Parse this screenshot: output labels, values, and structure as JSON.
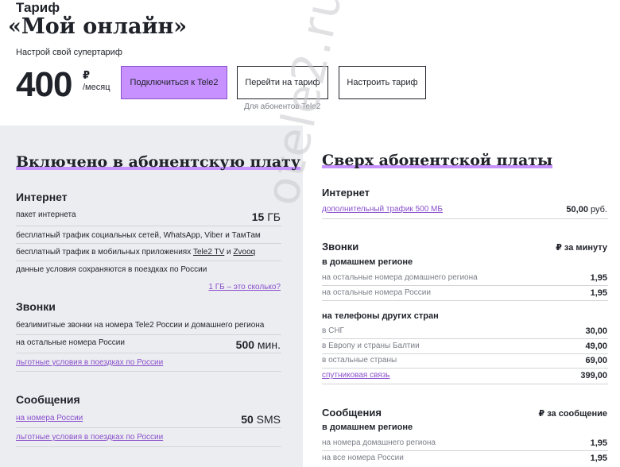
{
  "header": {
    "label": "Тариф",
    "title": "«Мой онлайн»",
    "subtitle": "Настрой свой супертариф",
    "price": "400",
    "currency": "₽",
    "period": "/месяц",
    "buttons": {
      "connect": "Подключиться к Tele2",
      "switch": "Перейти на тариф",
      "configure": "Настроить тариф"
    },
    "switch_note": "Для абонентов Tele2"
  },
  "included": {
    "title": "Включено в абонентскую плату",
    "internet": {
      "heading": "Интернет",
      "package_label": "пакет интернета",
      "package_value": "15",
      "package_unit": "ГБ",
      "line1": "бесплатный трафик социальных сетей, WhatsApp, Viber и ТамТам",
      "line2_prefix": "бесплатный трафик в мобильных приложениях ",
      "line2_app1": "Tele2 TV",
      "line2_and": " и ",
      "line2_app2": "Zvooq",
      "line3": "данные условия сохраняются в поездках по России",
      "gb_link": "1 ГБ – это сколько?"
    },
    "calls": {
      "heading": "Звонки",
      "line1": "безлимитные звонки на номера Tele2 России и домашнего региона",
      "line2": "на остальные номера России",
      "line2_value": "500",
      "line2_unit": "мин.",
      "link": "льготные условия в поездках по России"
    },
    "sms": {
      "heading": "Сообщения",
      "link1": "на номера России",
      "link1_value": "50",
      "link1_unit": "SMS",
      "link2": "льготные условия в поездках по России"
    }
  },
  "extra": {
    "title": "Сверх абонентской платы",
    "internet": {
      "heading": "Интернет",
      "link": "дополнительный трафик 500 МБ",
      "price": "50,00",
      "price_unit": "руб."
    },
    "calls": {
      "heading": "Звонки",
      "hint": "₽ за минуту",
      "home_heading": "в домашнем регионе",
      "home_rows": [
        {
          "label": "на остальные номера домашнего региона",
          "value": "1,95"
        },
        {
          "label": "на остальные номера России",
          "value": "1,95"
        }
      ],
      "intl_heading": "на телефоны других стран",
      "intl_rows": [
        {
          "label": "в СНГ",
          "value": "30,00"
        },
        {
          "label": "в Европу и страны Балтии",
          "value": "49,00"
        },
        {
          "label": "в остальные страны",
          "value": "69,00"
        },
        {
          "label": "спутниковая связь",
          "value": "399,00"
        }
      ]
    },
    "sms": {
      "heading": "Сообщения",
      "hint": "₽ за сообщение",
      "home_heading": "в домашнем регионе",
      "rows": [
        {
          "label": "на номера домашнего региона",
          "value": "1,95"
        },
        {
          "label": "на все номера России",
          "value": "1,95"
        }
      ]
    }
  },
  "watermark": "otele2.ru",
  "colors": {
    "accent": "#c792ff",
    "link": "#8a50cc",
    "panel": "#ecedf1",
    "text": "#1f2229"
  }
}
